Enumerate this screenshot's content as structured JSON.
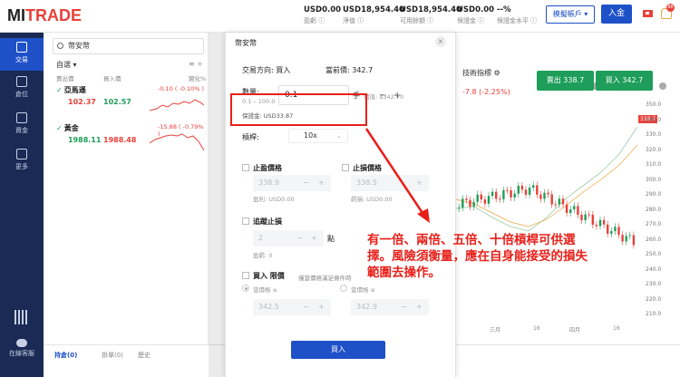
{
  "brand": {
    "prefix": "M",
    "name": "MITRADE",
    "red_part": "TRADE",
    "black_part": "MI"
  },
  "header": {
    "stats": [
      {
        "value": "USD0.00",
        "label": "盈虧 ⓘ"
      },
      {
        "value": "USD18,954.40",
        "label": "淨值 ⓘ"
      },
      {
        "value": "USD18,954.40",
        "label": "可用餘額 ⓘ"
      },
      {
        "value": "USD0.00",
        "label": "保證金 ⓘ"
      },
      {
        "value": "--%",
        "label": "保證金水平 ⓘ"
      }
    ],
    "account_button": "模擬帳戶 ▾",
    "deposit_button": "入金",
    "notification_count": "88"
  },
  "sidebar": {
    "items": [
      {
        "label": "交易",
        "icon": "chart-icon"
      },
      {
        "label": "倉位",
        "icon": "clipboard-icon"
      },
      {
        "label": "資金",
        "icon": "wallet-icon"
      },
      {
        "label": "更多",
        "icon": "grid-icon"
      }
    ],
    "customer_service": "在線客服"
  },
  "watchlist": {
    "search_value": "幣安幣",
    "tab": "自選 ▾",
    "tools": "≡ +",
    "col_sell": "賣出價",
    "col_buy": "買入價",
    "col_change": "變化%",
    "instruments": [
      {
        "name": "亞馬遜",
        "sell": "102.37",
        "buy": "102.57",
        "change": "-0.10 ( -0.10% )"
      },
      {
        "name": "黃金",
        "sell": "1988.11",
        "buy": "1988.48",
        "change": "-15.88 ( -0.79% )"
      }
    ]
  },
  "chart": {
    "tech_label": "技術指標",
    "change_text": "-7.8 (-2.25%)",
    "sell_button": "賣出 338.7",
    "buy_button": "買入 342.7",
    "current_price_tag": "338.7",
    "y_ticks": [
      "350.0",
      "340.0",
      "330.0",
      "320.0",
      "310.0",
      "300.0",
      "290.0",
      "280.0",
      "270.0",
      "260.0",
      "250.0",
      "240.0",
      "230.0",
      "220.0",
      "210.0"
    ],
    "x_ticks": [
      "三月",
      "16",
      "四月",
      "16"
    ]
  },
  "dialog": {
    "title": "幣安幣",
    "direction_label": "交易方向:",
    "direction_value": "買入",
    "current_price_label": "當前價:",
    "current_price_value": "342.7",
    "qty_label": "數量:",
    "qty_range": "0.1 – 100.0",
    "qty_value": "0.1",
    "qty_unit": "手",
    "qty_value_note": "價值: $342.70",
    "margin_label": "保證金:",
    "margin_value": "USD33.87",
    "leverage_label": "槓桿:",
    "leverage_value": "10x",
    "take_profit_label": "止盈價格",
    "take_profit_value": "338.9",
    "take_profit_note": "盈利: USD0.00",
    "stop_loss_label": "止損價格",
    "stop_loss_value": "338.5",
    "stop_loss_note": "虧損: USD0.00",
    "trailing_label": "追蹤止損",
    "trailing_value": "2",
    "trailing_unit": "點",
    "trailing_note": "盈虧: 0",
    "limit_label": "買入 限價",
    "limit_desc": "僅當價格滿足條件時",
    "limit_opt1": "當價格 ≤",
    "limit_opt2": "當價格 ≥",
    "limit_val1": "342.5",
    "limit_val2": "342.9",
    "buy_button": "買入"
  },
  "annotation": "有一倍、兩倍、五倍、十倍槓桿可供選擇。風險須衡量，應在自身能接受的損失範圍去操作。",
  "bottom_tabs": [
    "持倉(0)",
    "掛單(0)",
    "歷史"
  ],
  "colors": {
    "brand_red": "#e8403a",
    "primary_blue": "#1e50c8",
    "sidebar_navy": "#1a2a55",
    "buy_green": "#1e9e5a",
    "annotation_red": "#e8201a"
  }
}
